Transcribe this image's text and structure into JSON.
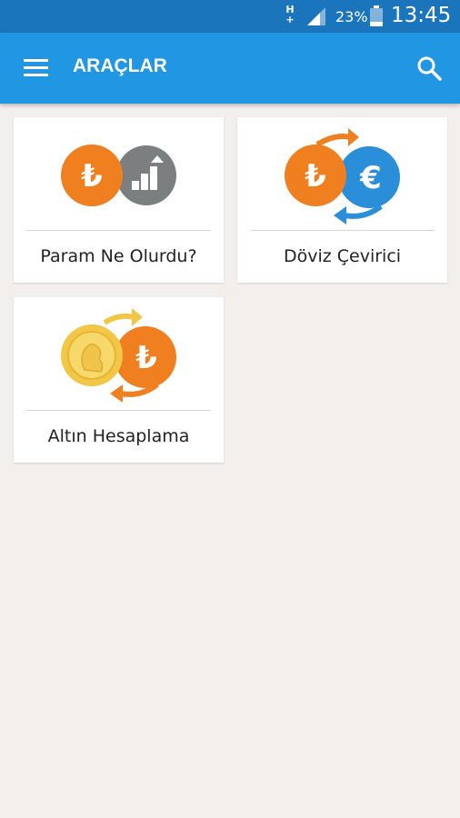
{
  "status_bar": {
    "network": "H+",
    "battery": "23%",
    "time": "13:45"
  },
  "app_bar": {
    "title": "ARAÇLAR",
    "menu_icon": "hamburger-menu-icon",
    "search_icon": "search-icon"
  },
  "tools": [
    {
      "label": "Param Ne Olurdu?",
      "icon": "lira-growth-chart-icon"
    },
    {
      "label": "Döviz Çevirici",
      "icon": "lira-euro-exchange-icon"
    },
    {
      "label": "Altın Hesaplama",
      "icon": "gold-coin-lira-exchange-icon"
    }
  ],
  "icon_symbols": {
    "lira": "₺",
    "euro": "€"
  },
  "colors": {
    "status_bar": "#1b75bd",
    "app_bar": "#2196e3",
    "background": "#f2efec",
    "orange": "#f07f1f",
    "blue": "#2a8fd8",
    "gray": "#7c7f80",
    "gold": "#f2c646"
  }
}
